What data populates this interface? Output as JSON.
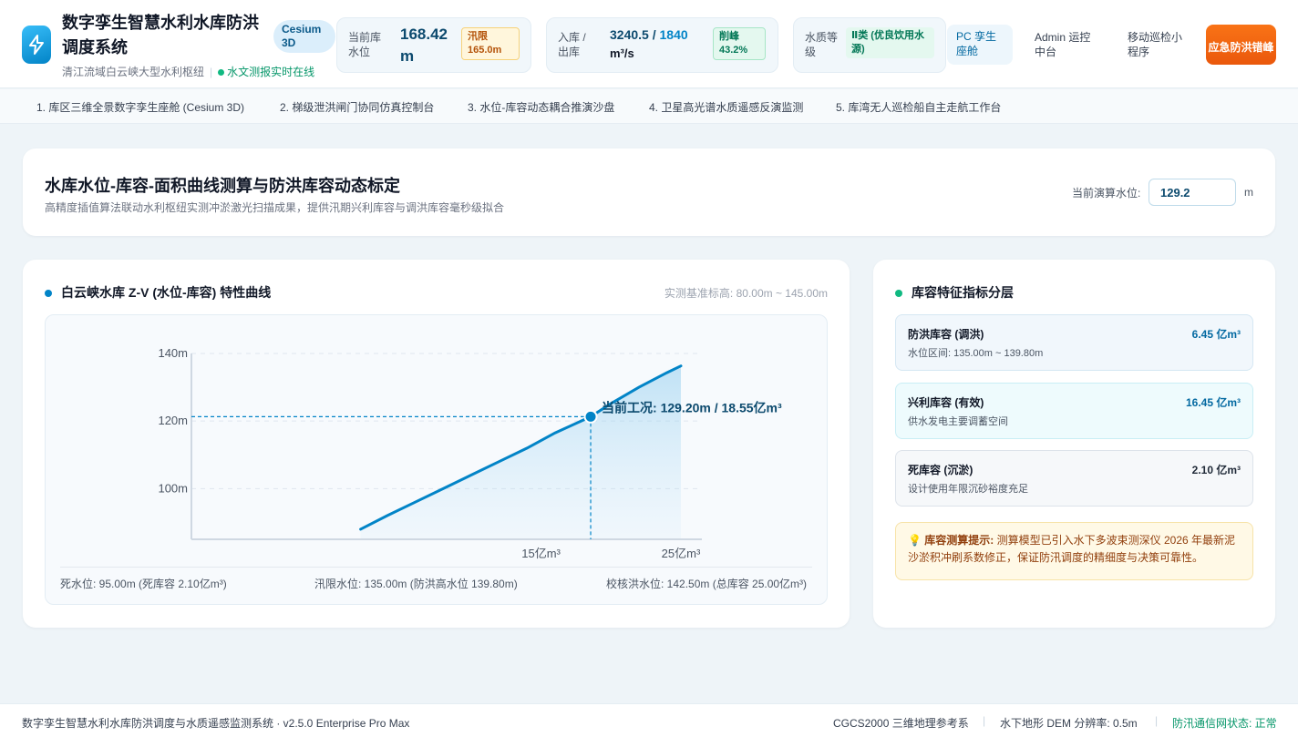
{
  "header": {
    "title": "数字孪生智慧水利水库防洪调度系统",
    "subtitle": "清江流域白云峡大型水利枢纽",
    "live_status": "水文测报实时在线",
    "cesium_badge": "Cesium 3D",
    "water_level": {
      "label": "当前库水位",
      "value": "168.42",
      "unit": "m",
      "badge": "汛限 165.0m"
    },
    "flow": {
      "label": "入库 / 出库",
      "inflow": "3240.5",
      "slash": " / ",
      "outflow": "1840",
      "unit": "m³/s",
      "badge": "削峰 43.2%"
    },
    "quality": {
      "label": "水质等级",
      "badge": "Ⅱ类 (优良饮用水源)"
    },
    "pc_link": "PC 孪生座舱",
    "admin_link": "Admin 运控中台",
    "mobile_link": "移动巡检小程序",
    "emergency_button": "应急防洪错峰"
  },
  "tabs": [
    "1. 库区三维全景数字孪生座舱 (Cesium 3D)",
    "2. 梯级泄洪闸门协同仿真控制台",
    "3. 水位-库容动态耦合推演沙盘",
    "4. 卫星高光谱水质遥感反演监测",
    "5. 库湾无人巡检船自主走航工作台"
  ],
  "hero": {
    "title": "水库水位-库容-面积曲线测算与防洪库容动态标定",
    "description": "高精度插值算法联动水利枢纽实测冲淤激光扫描成果，提供汛期兴利库容与调洪库容毫秒级拟合",
    "calc_label": "当前演算水位:",
    "calc_value": "129.2",
    "calc_unit": "m"
  },
  "chart_panel": {
    "title": "白云峡水库 Z-V (水位-库容) 特性曲线",
    "range": "实测基准标高: 80.00m ~ 145.00m",
    "foot_dead": "死水位: 95.00m (死库容 2.10亿m³)",
    "foot_flood_limit": "汛限水位: 135.00m (防洪高水位 139.80m)",
    "foot_check": "校核洪水位: 142.50m (总库容 25.00亿m³)"
  },
  "chart_data": {
    "type": "line",
    "x": [
      2.1,
      4,
      6,
      8,
      10,
      12,
      14,
      16,
      18.55,
      20,
      22,
      24,
      25
    ],
    "y": [
      88,
      92,
      96,
      100,
      104,
      108,
      112,
      116.5,
      121.3,
      125.2,
      130,
      134.3,
      136.3
    ],
    "ylim": [
      85,
      140
    ],
    "xlim": [
      -10,
      26.5
    ],
    "y_ticks": [
      {
        "v": 100,
        "label": "100m"
      },
      {
        "v": 120,
        "label": "120m"
      },
      {
        "v": 140,
        "label": "140m"
      }
    ],
    "x_ticks": [
      {
        "v": 15,
        "label": "15亿m³"
      },
      {
        "v": 25,
        "label": "25亿m³"
      }
    ],
    "current": {
      "x": 18.55,
      "y": 121.3,
      "label": "当前工况: 129.20m / 18.55亿m³"
    },
    "grid": true,
    "line_color": "#0284c7"
  },
  "layers_panel": {
    "title": "库容特征指标分层",
    "items": [
      {
        "name": "防洪库容 (调洪)",
        "value": "6.45 亿m³",
        "desc": "水位区间: 135.00m ~ 139.80m",
        "color": "#0369a1",
        "bg": "#f1f7fc",
        "border": "#d5e7f3"
      },
      {
        "name": "兴利库容 (有效)",
        "value": "16.45 亿m³",
        "desc": "供水发电主要调蓄空间",
        "color": "#0369a1",
        "bg": "#eefbfd",
        "border": "#c9eef5"
      },
      {
        "name": "死库容 (沉淤)",
        "value": "2.10 亿m³",
        "desc": "设计使用年限沉砂裕度充足",
        "color": "#1f2937",
        "bg": "#f6f8fa",
        "border": "#dde3ea"
      }
    ],
    "tip_title": "库容测算提示:",
    "tip_text": "测算模型已引入水下多波束测深仪 2026 年最新泥沙淤积冲刷系数修正，保证防汛调度的精细度与决策可靠性。"
  },
  "footer": {
    "left": "数字孪生智慧水利水库防洪调度与水质遥感监测系统 · v2.5.0 Enterprise Pro Max",
    "crs": "CGCS2000 三维地理参考系",
    "dem": "水下地形 DEM 分辨率: 0.5m",
    "comm": "防汛通信网状态: 正常"
  }
}
